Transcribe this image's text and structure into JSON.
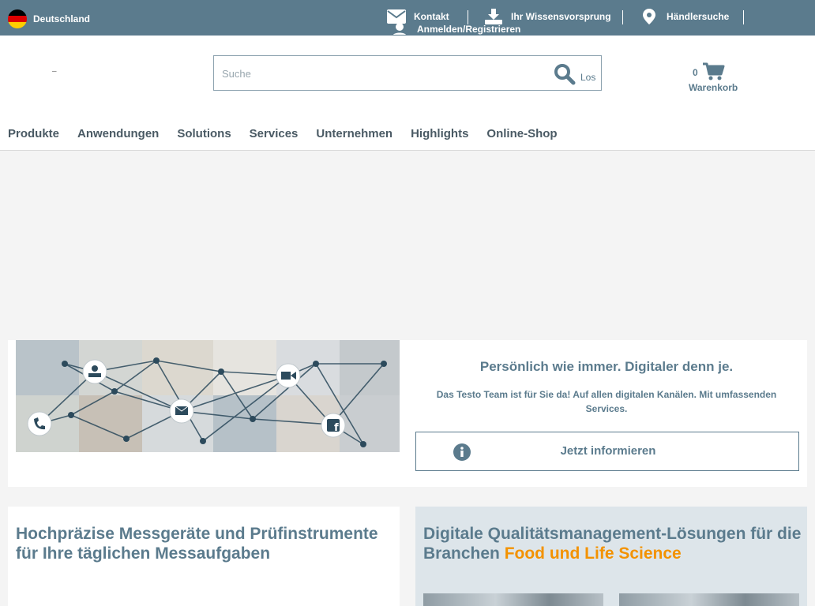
{
  "topbar": {
    "country": "Deutschland",
    "links": {
      "contact": "Kontakt",
      "knowledge": "Ihr Wissensvorsprung",
      "dealer": "Händlersuche",
      "login": "Anmelden/Registrieren"
    }
  },
  "header": {
    "logo_mark": "–",
    "search": {
      "placeholder": "Suche",
      "submit": "Los"
    },
    "cart": {
      "count": "0",
      "label": "Warenkorb"
    }
  },
  "nav": {
    "items": [
      "Produkte",
      "Anwendungen",
      "Solutions",
      "Services",
      "Unternehmen",
      "Highlights",
      "Online-Shop"
    ]
  },
  "promo": {
    "title": "Persönlich wie immer. Digitaler denn je.",
    "text": "Das Testo Team ist für Sie da! Auf allen digitalen Kanälen. Mit umfassenden Services.",
    "button": "Jetzt informieren"
  },
  "cards": {
    "left_title": "Hochpräzise Messgeräte und Prüfinstrumente für Ihre täglichen Messaufgaben",
    "right_title": "Digitale Qualitätsmanagement-Lösungen für die Branchen",
    "right_highlight": "Food und Life Science"
  },
  "colors": {
    "brand": "#5b7b8d",
    "accent": "#f39200",
    "light_panel": "#dde5ea"
  },
  "icons": {
    "contact": "envelope-icon",
    "knowledge": "download-icon",
    "dealer": "map-pin-icon",
    "login": "user-icon",
    "search": "search-icon",
    "cart": "cart-icon",
    "info": "info-icon"
  }
}
